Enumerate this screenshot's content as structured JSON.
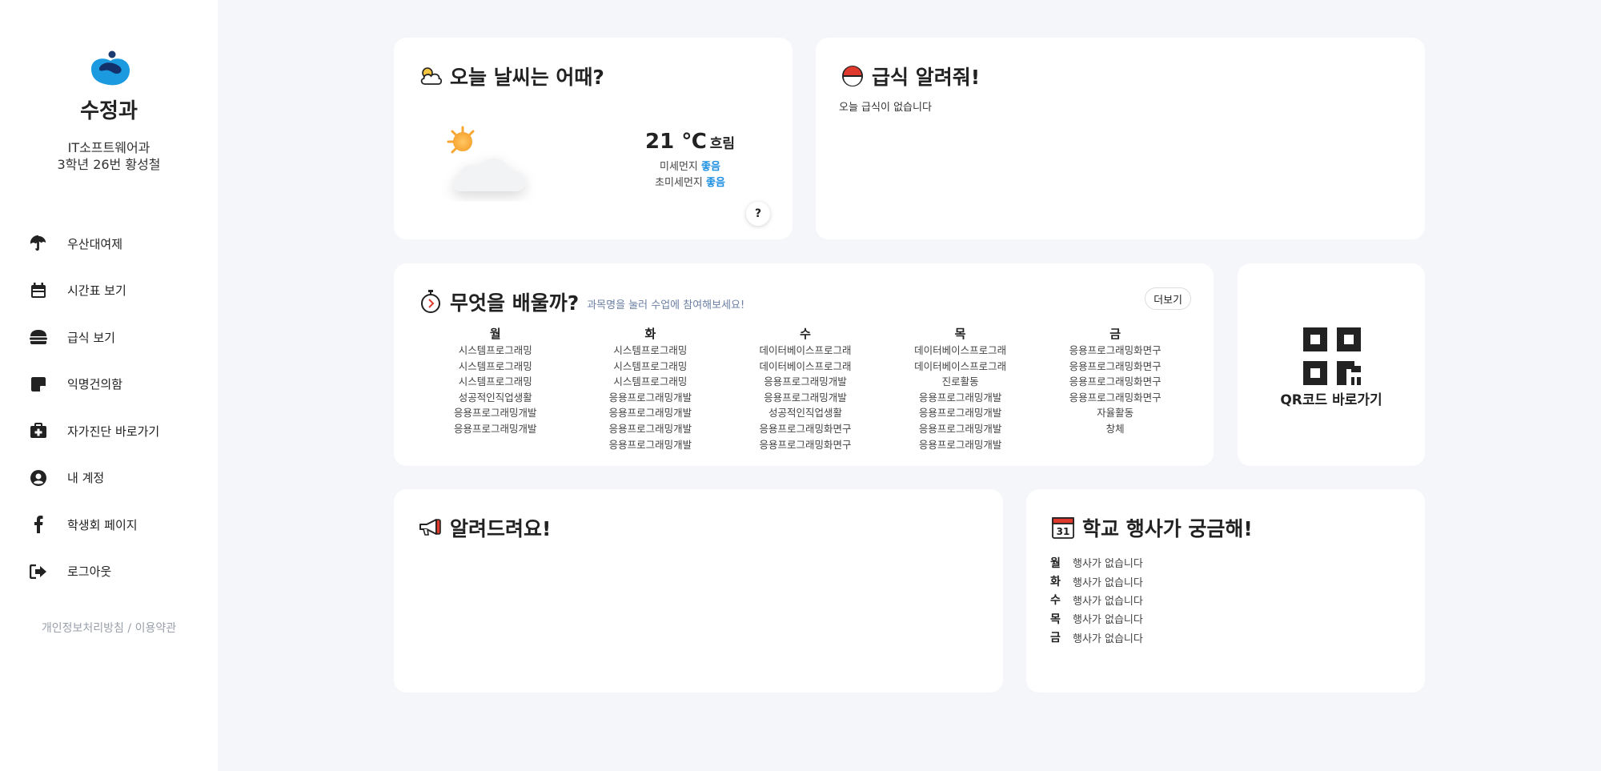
{
  "sidebar": {
    "brand": "수정과",
    "dept_line1": "IT소프트웨어과",
    "dept_line2": "3학년 26번 황성철",
    "items": [
      {
        "label": "우산대여제",
        "icon": "umbrella-icon"
      },
      {
        "label": "시간표 보기",
        "icon": "calendar-icon"
      },
      {
        "label": "급식 보기",
        "icon": "burger-icon"
      },
      {
        "label": "익명건의함",
        "icon": "note-icon"
      },
      {
        "label": "자가진단 바로가기",
        "icon": "medical-kit-icon"
      },
      {
        "label": "내 계정",
        "icon": "user-circle-icon"
      },
      {
        "label": "학생회 페이지",
        "icon": "facebook-icon"
      },
      {
        "label": "로그아웃",
        "icon": "logout-icon"
      }
    ],
    "policy_privacy": "개인정보처리방침",
    "policy_sep": " / ",
    "policy_terms": "이용약관"
  },
  "weather": {
    "title": "오늘 날씨는 어때?",
    "temp": "21 ℃",
    "condition": "흐림",
    "pm10_label": "미세먼지",
    "pm10_value": "좋음",
    "pm25_label": "초미세먼지",
    "pm25_value": "좋음",
    "help": "?"
  },
  "meal": {
    "title": "급식 알려줘!",
    "text": "오늘 급식이 없습니다"
  },
  "timetable": {
    "title": "무엇을 배울까?",
    "subtitle": "과목명을 눌러 수업에 참여해보세요!",
    "more": "더보기",
    "days": [
      {
        "day": "월",
        "items": [
          "시스템프로그래밍",
          "시스템프로그래밍",
          "시스템프로그래밍",
          "성공적인직업생활",
          "응용프로그래밍개발",
          "응용프로그래밍개발"
        ]
      },
      {
        "day": "화",
        "items": [
          "시스템프로그래밍",
          "시스템프로그래밍",
          "시스템프로그래밍",
          "응용프로그래밍개발",
          "응용프로그래밍개발",
          "응용프로그래밍개발",
          "응용프로그래밍개발"
        ]
      },
      {
        "day": "수",
        "items": [
          "데이터베이스프로그래",
          "데이터베이스프로그래",
          "응용프로그래밍개발",
          "응용프로그래밍개발",
          "성공적인직업생활",
          "응용프로그래밍화면구",
          "응용프로그래밍화면구"
        ]
      },
      {
        "day": "목",
        "items": [
          "데이터베이스프로그래",
          "데이터베이스프로그래",
          "진로활동",
          "응용프로그래밍개발",
          "응용프로그래밍개발",
          "응용프로그래밍개발",
          "응용프로그래밍개발"
        ]
      },
      {
        "day": "금",
        "items": [
          "응용프로그래밍화면구",
          "응용프로그래밍화면구",
          "응용프로그래밍화면구",
          "응용프로그래밍화면구",
          "자율활동",
          "창체"
        ]
      }
    ]
  },
  "qr": {
    "label": "QR코드 바로가기"
  },
  "notice": {
    "title": "알려드려요!"
  },
  "events": {
    "title": "학교 행사가 궁금해!",
    "rows": [
      {
        "day": "월",
        "text": "행사가 없습니다"
      },
      {
        "day": "화",
        "text": "행사가 없습니다"
      },
      {
        "day": "수",
        "text": "행사가 없습니다"
      },
      {
        "day": "목",
        "text": "행사가 없습니다"
      },
      {
        "day": "금",
        "text": "행사가 없습니다"
      }
    ]
  },
  "colors": {
    "accent_blue": "#1d8fe1",
    "logo_blue": "#1b9ae0",
    "background": "#f5f6f9"
  }
}
